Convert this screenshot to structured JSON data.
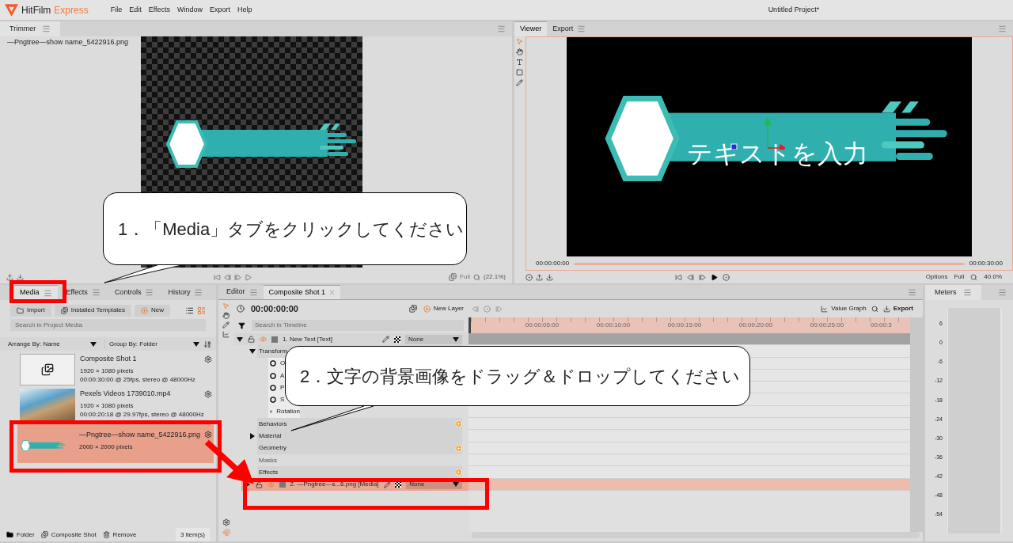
{
  "app": {
    "name": "HitFilm",
    "edition": "Express",
    "menu": [
      "File",
      "Edit",
      "Effects",
      "Window",
      "Export",
      "Help"
    ],
    "project_title": "Untitled Project*"
  },
  "trimmer": {
    "tab": "Trimmer",
    "file": "—Pngtree—show name_5422916.png",
    "quality": "Full",
    "zoom": "(22.1%)"
  },
  "viewer": {
    "tabs": [
      {
        "label": "Viewer",
        "selected": true
      },
      {
        "label": "Export",
        "selected": false
      }
    ],
    "overlay_text": "テキストを入力",
    "time_start": "00:00:00:00",
    "time_end": "00:00:30:00",
    "options": "Options",
    "quality": "Full",
    "zoom": "40.0%"
  },
  "media": {
    "tabs": [
      {
        "label": "Media",
        "selected": true
      },
      {
        "label": "Effects",
        "selected": false
      },
      {
        "label": "Controls",
        "selected": false
      },
      {
        "label": "History",
        "selected": false
      }
    ],
    "import": "Import",
    "templates": "Installed Templates",
    "new": "New",
    "search_placeholder": "Search in Project Media",
    "arrange": "Arrange By: Name",
    "group": "Group By: Folder",
    "items": [
      {
        "kind": "composite",
        "name": "Composite Shot 1",
        "details": [
          "1920 × 1080 pixels",
          "00:00:30:00 @ 25fps, stereo @ 48000Hz"
        ],
        "selected": false
      },
      {
        "kind": "video",
        "name": "Pexels Videos 1739010.mp4",
        "details": [
          "1920 × 1080 pixels",
          "00:00:20:18 @ 29.97fps, stereo @ 48000Hz"
        ],
        "selected": false
      },
      {
        "kind": "image",
        "name": "—Pngtree—show name_5422916.png",
        "details": [
          "2000 × 2000 pixels"
        ],
        "selected": true
      }
    ],
    "footer": [
      "Folder",
      "Composite Shot",
      "Remove"
    ],
    "count": "3 item(s)"
  },
  "editor": {
    "tabs": [
      {
        "label": "Editor",
        "selected": false
      },
      {
        "label": "Composite Shot 1",
        "selected": true
      }
    ],
    "time": "00:00:00:00",
    "new_layer": "New Layer",
    "search_placeholder": "Search in Timeline",
    "value_graph": "Value Graph",
    "export": "Export",
    "ruler": [
      "00:00:05:00",
      "00:00:10:00",
      "00:00:15:00",
      "00:00:20:00",
      "00:00:25:00",
      "00:00:3"
    ],
    "layers": [
      {
        "name": "1. New Text [Text]",
        "blend": "None",
        "selected": false,
        "expanded": true,
        "children": [
          {
            "label": "Transform",
            "kind": "group",
            "expanded": true,
            "children": [
              {
                "label": "O"
              },
              {
                "label": "A"
              },
              {
                "label": "P"
              },
              {
                "label": "S"
              },
              {
                "label": "Rotation"
              }
            ]
          },
          {
            "label": "Behaviors",
            "kind": "add"
          },
          {
            "label": "Material",
            "kind": "group",
            "expanded": false
          },
          {
            "label": "Geometry",
            "kind": "add"
          },
          {
            "label": "Masks",
            "kind": "section"
          },
          {
            "label": "Effects",
            "kind": "add"
          }
        ]
      },
      {
        "name": "2. —Pngtree—s...6.png [Media]",
        "blend": "None",
        "selected": true,
        "expanded": false
      }
    ]
  },
  "meters": {
    "title": "Meters",
    "scale": [
      "6",
      "0",
      "-6",
      "-12",
      "-18",
      "-24",
      "-30",
      "-36",
      "-42",
      "-48",
      "-54"
    ]
  },
  "annotations": [
    "1．「Media」タブをクリックしてください",
    "2．文字の背景画像をドラッグ＆ドロップしてください"
  ]
}
